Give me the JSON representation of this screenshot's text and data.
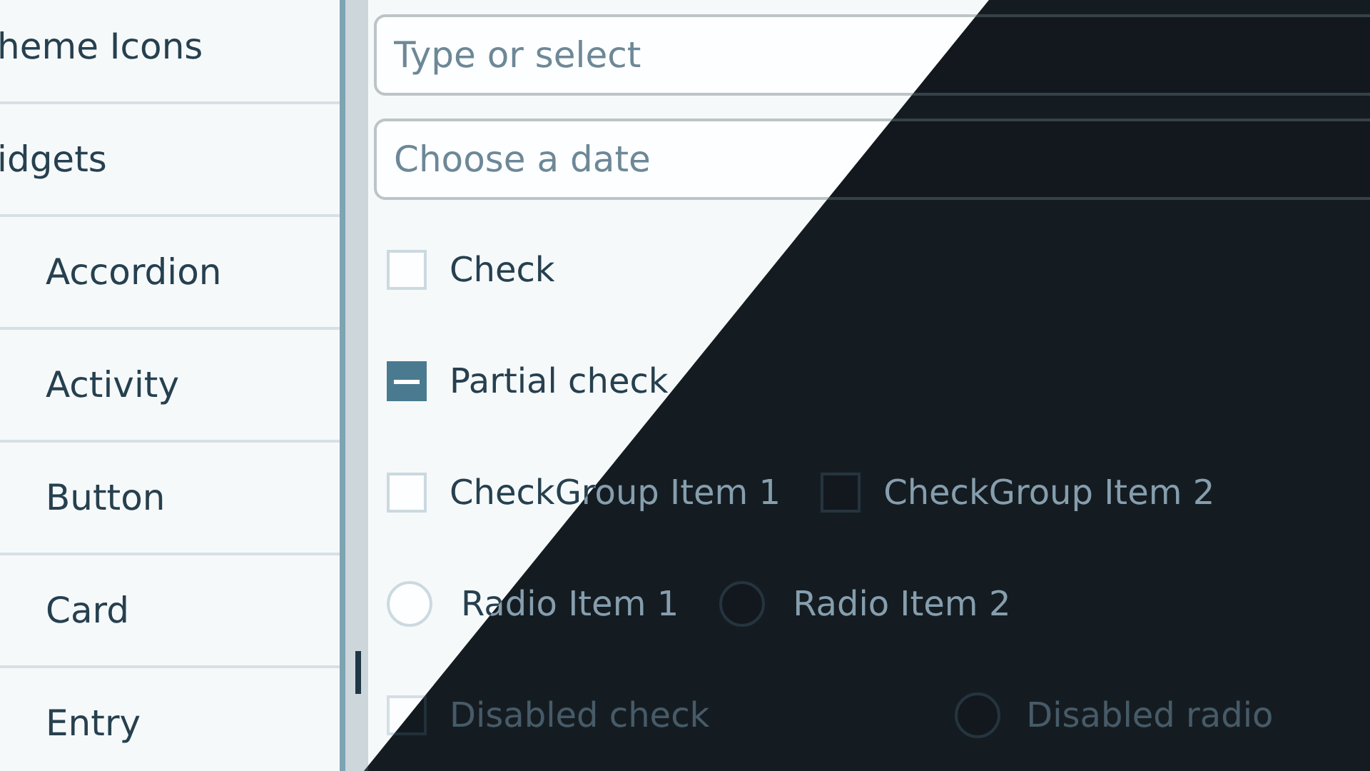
{
  "sidebar": {
    "items": [
      {
        "label": "heme Icons"
      },
      {
        "label": "idgets",
        "children": [
          {
            "label": "Accordion"
          },
          {
            "label": "Activity"
          },
          {
            "label": "Button"
          },
          {
            "label": "Card"
          },
          {
            "label": "Entry"
          }
        ]
      }
    ]
  },
  "combo": {
    "placeholder": "Type or select"
  },
  "date": {
    "placeholder": "Choose a date"
  },
  "rows": [
    [
      {
        "kind": "checkbox",
        "label": "Check",
        "checked": false,
        "indeterminate": false,
        "disabled": false
      }
    ],
    [
      {
        "kind": "checkbox",
        "label": "Partial check",
        "indeterminate": true,
        "disabled": false
      }
    ],
    [
      {
        "kind": "checkbox",
        "label": "CheckGroup Item 1",
        "checked": false,
        "indeterminate": false,
        "disabled": false
      },
      {
        "kind": "checkbox",
        "label": "CheckGroup Item 2",
        "checked": false,
        "indeterminate": false,
        "disabled": false
      }
    ],
    [
      {
        "kind": "radio",
        "label": "Radio Item 1",
        "selected": false,
        "disabled": false
      },
      {
        "kind": "radio",
        "label": "Radio Item 2",
        "selected": false,
        "disabled": false
      }
    ],
    [
      {
        "kind": "checkbox",
        "label": "Disabled check",
        "checked": false,
        "indeterminate": false,
        "disabled": true
      },
      {
        "kind": "radio",
        "label": "Disabled radio",
        "selected": false,
        "disabled": true
      }
    ]
  ]
}
